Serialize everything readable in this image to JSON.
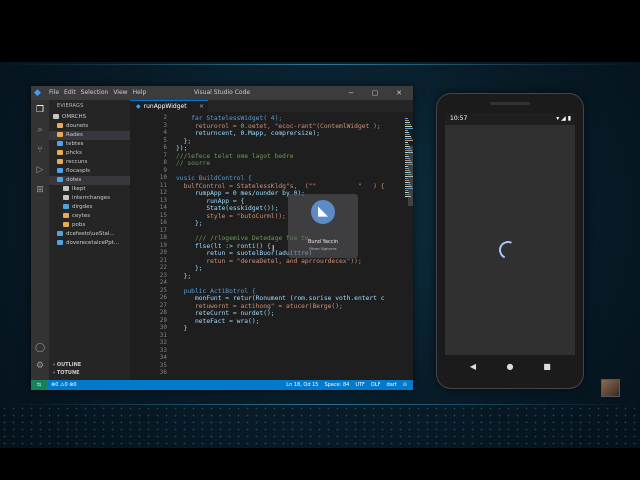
{
  "vscode": {
    "window_title": "Visual Studio Code",
    "menu": [
      "File",
      "Edit",
      "Selection",
      "View",
      "Help"
    ],
    "window_controls": [
      "−",
      "▢",
      "✕"
    ],
    "sidebar": {
      "header": "EVIERAGS",
      "items": [
        {
          "label": "OMRCHS",
          "color": "#c5c5c5"
        },
        {
          "label": "dounets",
          "color": "#e8ab53"
        },
        {
          "label": "Rades",
          "color": "#e8ab53",
          "selected": true
        },
        {
          "label": "tebtes",
          "color": "#4fa3e0"
        },
        {
          "label": "phcks",
          "color": "#e8ab53"
        },
        {
          "label": "reccuns",
          "color": "#e8ab53"
        },
        {
          "label": "flocaspls",
          "color": "#4fa3e0"
        },
        {
          "label": "dotes",
          "color": "#4fa3e0",
          "selected": true
        },
        {
          "label": "lkept",
          "color": "#c5c5c5"
        },
        {
          "label": "interrchanges",
          "color": "#c5c5c5"
        },
        {
          "label": "dirgdes",
          "color": "#4fa3e0"
        },
        {
          "label": "ceytes",
          "color": "#e8ab53"
        },
        {
          "label": "pobs",
          "color": "#e8ab53"
        },
        {
          "label": "dcefeeto\\ueStal...",
          "color": "#4fa3e0"
        },
        {
          "label": "doverecetaicePpt...",
          "color": "#4fa3e0"
        }
      ],
      "outline": "OUTLINE",
      "timeline": "TOTUNE"
    },
    "tab": {
      "label": "runAppWidget",
      "close": "×"
    },
    "line_numbers": [
      "2",
      "3",
      "4",
      "5",
      "6",
      "7",
      "8",
      "9",
      "10",
      "11",
      "12",
      "13",
      "14",
      "15",
      "16",
      "17",
      "18",
      "19",
      "20",
      "21",
      "22",
      "23",
      "24",
      "25",
      "26",
      "27",
      "28",
      "29",
      "30",
      "31",
      "32",
      "33",
      "34",
      "35",
      "36"
    ],
    "code_lines": [
      "    far StatelessWidget( 4);",
      "     returorol = 0.oetet, \"ecoc-rant\"(ContemlWidget );",
      "     returncent, 0.Mapp, comprersize);",
      "  };",
      "});",
      "///lefece telet ome lagot bedre",
      "// sourre",
      "",
      "vusic BuildControl {",
      "  bulfControl = StatelessKldg\"s,  (\"\"           \"   ) {",
      "     rumpApp = 0 mes/ounder by 0);",
      "        runApp = {",
      "        State(esskidget());",
      "        style = \"butoCurml();",
      "     };",
      "",
      "     /// /rlogemive Detedage foe te",
      "     flse(lt :> ronti() {",
      "        retun = suotelBuor(aduittre)",
      "        retun = \"dereaDetel, and aprrourdecex\"));",
      "     };",
      "  };",
      "",
      "  public ActiBotrol {",
      "     monFunt = retur(Ronument (rom.sorise voth.entert c",
      "     retuwornt = actihong\" = atucer(Berge();",
      "     reteCurnt = nurdet();",
      "     neteFact = wra();",
      "  }"
    ],
    "overlay": {
      "name": "Bund Yaccin",
      "sub": "Fitcen Sighcens"
    },
    "status": {
      "remote": "⇆",
      "problems": "⊗0 ⚠0",
      "watch": "⊗0",
      "ln_col": "Ln 18, Od 15",
      "spaces": "Space: 84",
      "encoding": "UTF",
      "eol": "OLF",
      "lang": "dart",
      "extra": "⊙"
    }
  },
  "phone": {
    "time": "10:57",
    "icons": "▾ ◢ ▮",
    "nav": [
      "◀",
      "●",
      "■"
    ]
  }
}
